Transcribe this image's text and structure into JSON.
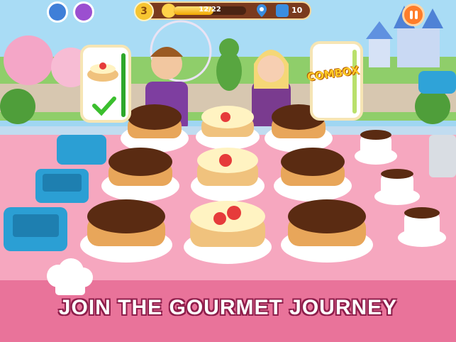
{
  "hud": {
    "level": "3",
    "xp_text": "12/22",
    "xp_progress": 0.545,
    "gems": "10"
  },
  "orders": {
    "right_label": "COMBOX"
  },
  "banner": {
    "tagline": "JOIN THE GOURMET JOURNEY"
  },
  "colors": {
    "banner": "#e9739a",
    "hud_bar": "#7a3a1e",
    "pause": "#ff7d2a"
  }
}
